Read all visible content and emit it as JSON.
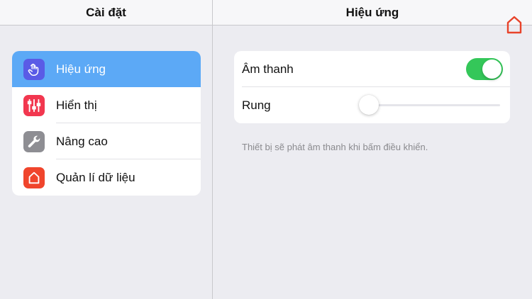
{
  "left": {
    "title": "Cài đặt",
    "items": [
      {
        "label": "Hiệu ứng",
        "icon": "tap-hand-icon",
        "icon_bg": "#5a5be6",
        "selected": true
      },
      {
        "label": "Hiển thị",
        "icon": "sliders-icon",
        "icon_bg": "#f2374f",
        "selected": false
      },
      {
        "label": "Nâng cao",
        "icon": "wrench-icon",
        "icon_bg": "#8e8e93",
        "selected": false
      },
      {
        "label": "Quản lí dữ liệu",
        "icon": "home-icon",
        "icon_bg": "#f0452c",
        "selected": false
      }
    ]
  },
  "right": {
    "title": "Hiệu ứng",
    "home_icon": "home-outline-icon",
    "home_icon_color": "#e8432a",
    "sound": {
      "label": "Âm thanh",
      "enabled": true,
      "toggle_color": "#34c759"
    },
    "vibration": {
      "label": "Rung",
      "level": 0
    },
    "note": "Thiết bị sẽ phát âm thanh khi bấm điều khiển."
  },
  "colors": {
    "selected_bg": "#5ca9f6",
    "background": "#ececf1"
  }
}
